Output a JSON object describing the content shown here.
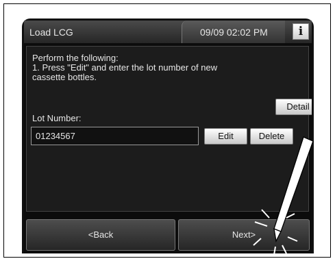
{
  "header": {
    "title": "Load LCG",
    "datetime": "09/09 02:02 PM",
    "info_label": "i"
  },
  "main": {
    "instructions": {
      "line1": "Perform the following:",
      "line2": "1. Press \"Edit\" and enter the lot number of new",
      "line3": "cassette bottles."
    },
    "detail_label": "Detail",
    "lot_label": "Lot Number:",
    "lot_value": "01234567",
    "edit_label": "Edit",
    "delete_label": "Delete"
  },
  "footer": {
    "back_label": "<Back",
    "next_label": "Next>"
  }
}
